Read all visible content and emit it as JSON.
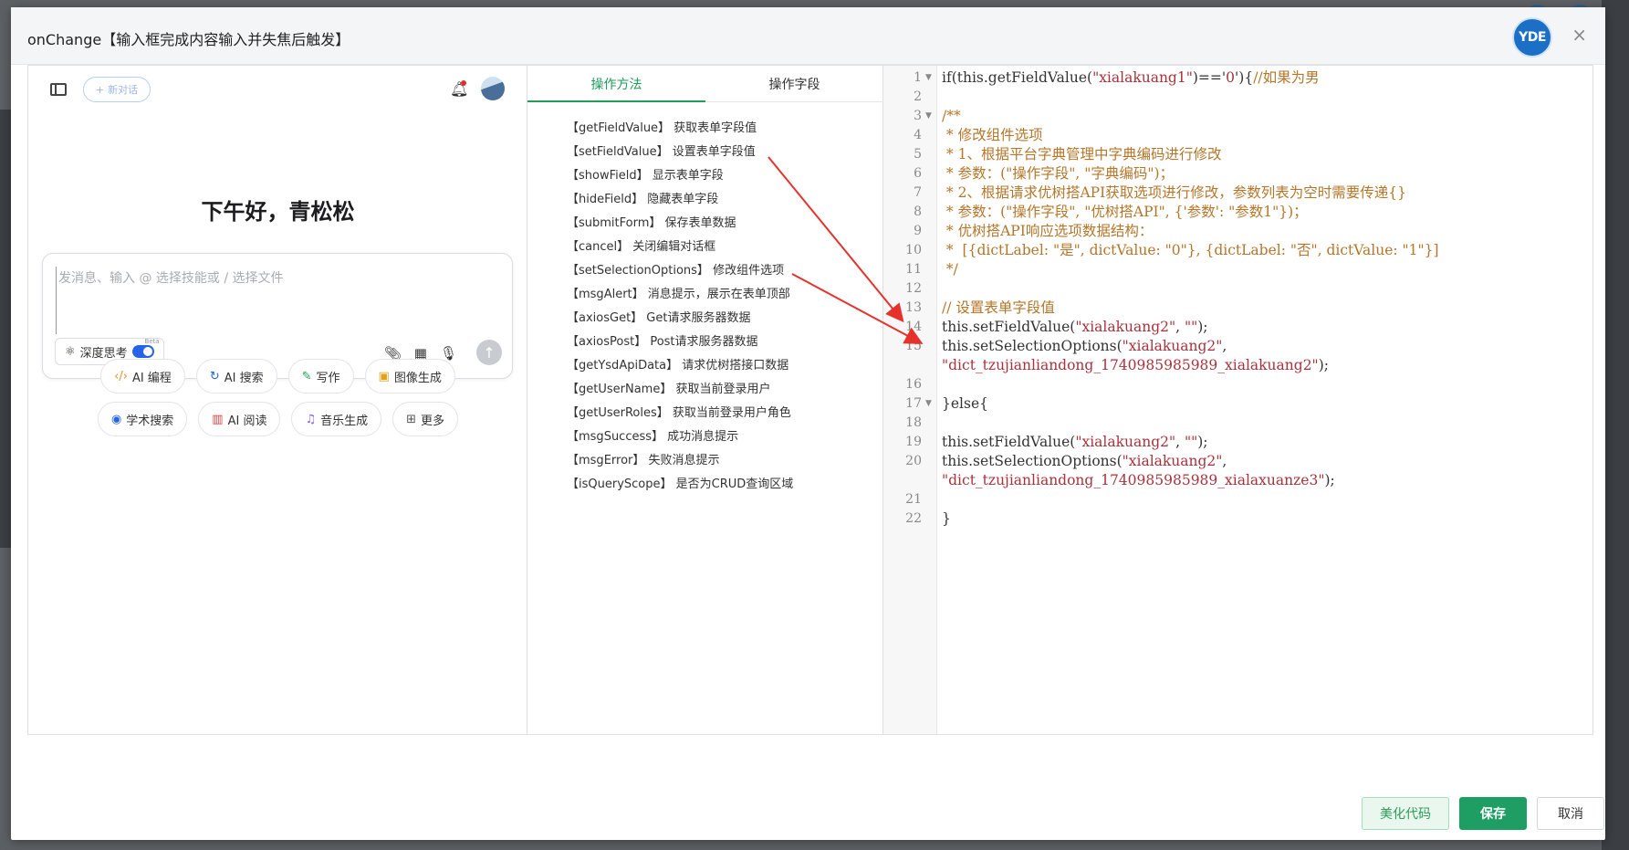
{
  "dialog": {
    "title": "onChange【输入框完成内容输入并失焦后触发】",
    "logo_text": "YDE",
    "close_icon": "×"
  },
  "ai": {
    "new_chat_label": "新对话",
    "greeting": "下午好，青松松",
    "input_placeholder": "发消息、输入 @ 选择技能或 / 选择文件",
    "deep_think_label": "深度思考",
    "beta_label": "Beta",
    "quick_actions_row1": [
      {
        "icon": "code-icon",
        "glyph": "‹/›",
        "label": "AI 编程",
        "color": "#e0912a"
      },
      {
        "icon": "search-refresh-icon",
        "glyph": "↻",
        "label": "AI 搜索",
        "color": "#2563eb"
      },
      {
        "icon": "pen-icon",
        "glyph": "✎",
        "label": "写作",
        "color": "#22a35a"
      },
      {
        "icon": "image-icon",
        "glyph": "▣",
        "label": "图像生成",
        "color": "#e0a020"
      }
    ],
    "quick_actions_row2": [
      {
        "icon": "academic-icon",
        "glyph": "◉",
        "label": "学术搜索",
        "color": "#2563eb"
      },
      {
        "icon": "book-icon",
        "glyph": "▥",
        "label": "AI 阅读",
        "color": "#e03c3c"
      },
      {
        "icon": "music-icon",
        "glyph": "♫",
        "label": "音乐生成",
        "color": "#8b5cf6"
      },
      {
        "icon": "grid-icon",
        "glyph": "⊞",
        "label": "更多",
        "color": "#555555"
      }
    ]
  },
  "methods": {
    "tabs": [
      "操作方法",
      "操作字段"
    ],
    "items": [
      "【getFieldValue】 获取表单字段值",
      "【setFieldValue】 设置表单字段值",
      "【showField】 显示表单字段",
      "【hideField】 隐藏表单字段",
      "【submitForm】 保存表单数据",
      "【cancel】 关闭编辑对话框",
      "【setSelectionOptions】 修改组件选项",
      "【msgAlert】 消息提示，展示在表单顶部",
      "【axiosGet】 Get请求服务器数据",
      "【axiosPost】 Post请求服务器数据",
      "【getYsdApiData】 请求优树搭接口数据",
      "【getUserName】 获取当前登录用户",
      "【getUserRoles】 获取当前登录用户角色",
      "【msgSuccess】 成功消息提示",
      "【msgError】 失败消息提示",
      "【isQueryScope】 是否为CRUD查询区域"
    ]
  },
  "code": {
    "lines": [
      {
        "n": "1",
        "fold": true,
        "segs": [
          [
            "c-kw",
            "if(this.getFieldValue("
          ],
          [
            "c-str",
            "\"xialakuang1\""
          ],
          [
            "c-kw",
            ")=='"
          ],
          [
            "c-str",
            "0"
          ],
          [
            "c-kw",
            "'){"
          ],
          [
            "c-com",
            "//如果为男"
          ]
        ]
      },
      {
        "n": "2",
        "fold": false,
        "segs": []
      },
      {
        "n": "3",
        "fold": true,
        "segs": [
          [
            "c-com",
            "/**"
          ]
        ]
      },
      {
        "n": "4",
        "fold": false,
        "segs": [
          [
            "c-com",
            " * 修改组件选项"
          ]
        ]
      },
      {
        "n": "5",
        "fold": false,
        "segs": [
          [
            "c-com",
            " * 1、根据平台字典管理中字典编码进行修改"
          ]
        ]
      },
      {
        "n": "6",
        "fold": false,
        "segs": [
          [
            "c-com",
            " * 参数：(\"操作字段\", \"字典编码\")；"
          ]
        ]
      },
      {
        "n": "7",
        "fold": false,
        "segs": [
          [
            "c-com",
            " * 2、根据请求优树搭API获取选项进行修改，参数列表为空时需要传递{}"
          ]
        ]
      },
      {
        "n": "8",
        "fold": false,
        "segs": [
          [
            "c-com",
            " * 参数：(\"操作字段\", \"优树搭API\", {'参数': \"参数1\"})；"
          ]
        ]
      },
      {
        "n": "9",
        "fold": false,
        "segs": [
          [
            "c-com",
            " * 优树搭API响应选项数据结构："
          ]
        ]
      },
      {
        "n": "10",
        "fold": false,
        "segs": [
          [
            "c-com",
            " *  [{dictLabel: \"是\", dictValue: \"0\"}, {dictLabel: \"否\", dictValue: \"1\"}]"
          ]
        ]
      },
      {
        "n": "11",
        "fold": false,
        "segs": [
          [
            "c-com",
            " */"
          ]
        ]
      },
      {
        "n": "12",
        "fold": false,
        "segs": []
      },
      {
        "n": "13",
        "fold": false,
        "segs": [
          [
            "c-com",
            "// 设置表单字段值"
          ]
        ]
      },
      {
        "n": "14",
        "fold": false,
        "segs": [
          [
            "c-kw",
            "this.setFieldValue("
          ],
          [
            "c-str",
            "\"xialakuang2\""
          ],
          [
            "c-kw",
            ", "
          ],
          [
            "c-str",
            "\"\""
          ],
          [
            "c-kw",
            ");"
          ]
        ]
      },
      {
        "n": "15",
        "fold": false,
        "segs": [
          [
            "c-kw",
            "this.setSelectionOptions("
          ],
          [
            "c-str",
            "\"xialakuang2\""
          ],
          [
            "c-kw",
            ","
          ]
        ]
      },
      {
        "n": "",
        "fold": false,
        "segs": [
          [
            "c-str",
            "\"dict_tzujianliandong_1740985985989_xialakuang2\""
          ],
          [
            "c-kw",
            ");"
          ]
        ]
      },
      {
        "n": "16",
        "fold": false,
        "segs": []
      },
      {
        "n": "17",
        "fold": true,
        "segs": [
          [
            "c-kw",
            "}else{"
          ]
        ]
      },
      {
        "n": "18",
        "fold": false,
        "segs": []
      },
      {
        "n": "19",
        "fold": false,
        "segs": [
          [
            "c-kw",
            "this.setFieldValue("
          ],
          [
            "c-str",
            "\"xialakuang2\""
          ],
          [
            "c-kw",
            ", "
          ],
          [
            "c-str",
            "\"\""
          ],
          [
            "c-kw",
            ");"
          ]
        ]
      },
      {
        "n": "20",
        "fold": false,
        "segs": [
          [
            "c-kw",
            "this.setSelectionOptions("
          ],
          [
            "c-str",
            "\"xialakuang2\""
          ],
          [
            "c-kw",
            ","
          ]
        ]
      },
      {
        "n": "",
        "fold": false,
        "segs": [
          [
            "c-str",
            "\"dict_tzujianliandong_1740985985989_xialaxuanze3\""
          ],
          [
            "c-kw",
            ");"
          ]
        ]
      },
      {
        "n": "21",
        "fold": false,
        "segs": []
      },
      {
        "n": "22",
        "fold": false,
        "segs": [
          [
            "c-kw",
            "}"
          ]
        ]
      }
    ]
  },
  "footer": {
    "beautify_label": "美化代码",
    "save_label": "保存",
    "cancel_label": "取消"
  },
  "colors": {
    "accent": "#1e9e62",
    "arrow": "#e5322d"
  }
}
